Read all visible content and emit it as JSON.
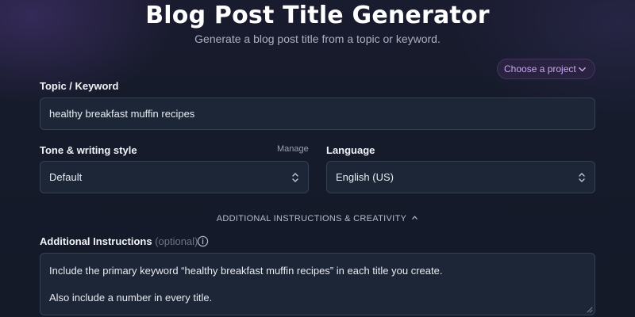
{
  "header": {
    "title": "Blog Post Title Generator",
    "subtitle": "Generate a blog post title from a topic or keyword."
  },
  "project_selector": {
    "label": "Choose a project",
    "icon": "chevron-down-icon",
    "color": "#c9a7f5"
  },
  "topic": {
    "label": "Topic / Keyword",
    "value": "healthy breakfast muffin recipes"
  },
  "tone": {
    "label": "Tone & writing style",
    "manage_label": "Manage",
    "value": "Default"
  },
  "language": {
    "label": "Language",
    "value": "English (US)"
  },
  "advanced_toggle": {
    "label": "ADDITIONAL INSTRUCTIONS & CREATIVITY",
    "icon": "chevron-up-icon"
  },
  "instructions": {
    "label": "Additional Instructions",
    "optional_label": "(optional)",
    "icon": "info-icon",
    "line1": "Include the primary keyword “healthy breakfast muffin recipes” in each title you create.",
    "line2": "Also include a number in every title."
  }
}
